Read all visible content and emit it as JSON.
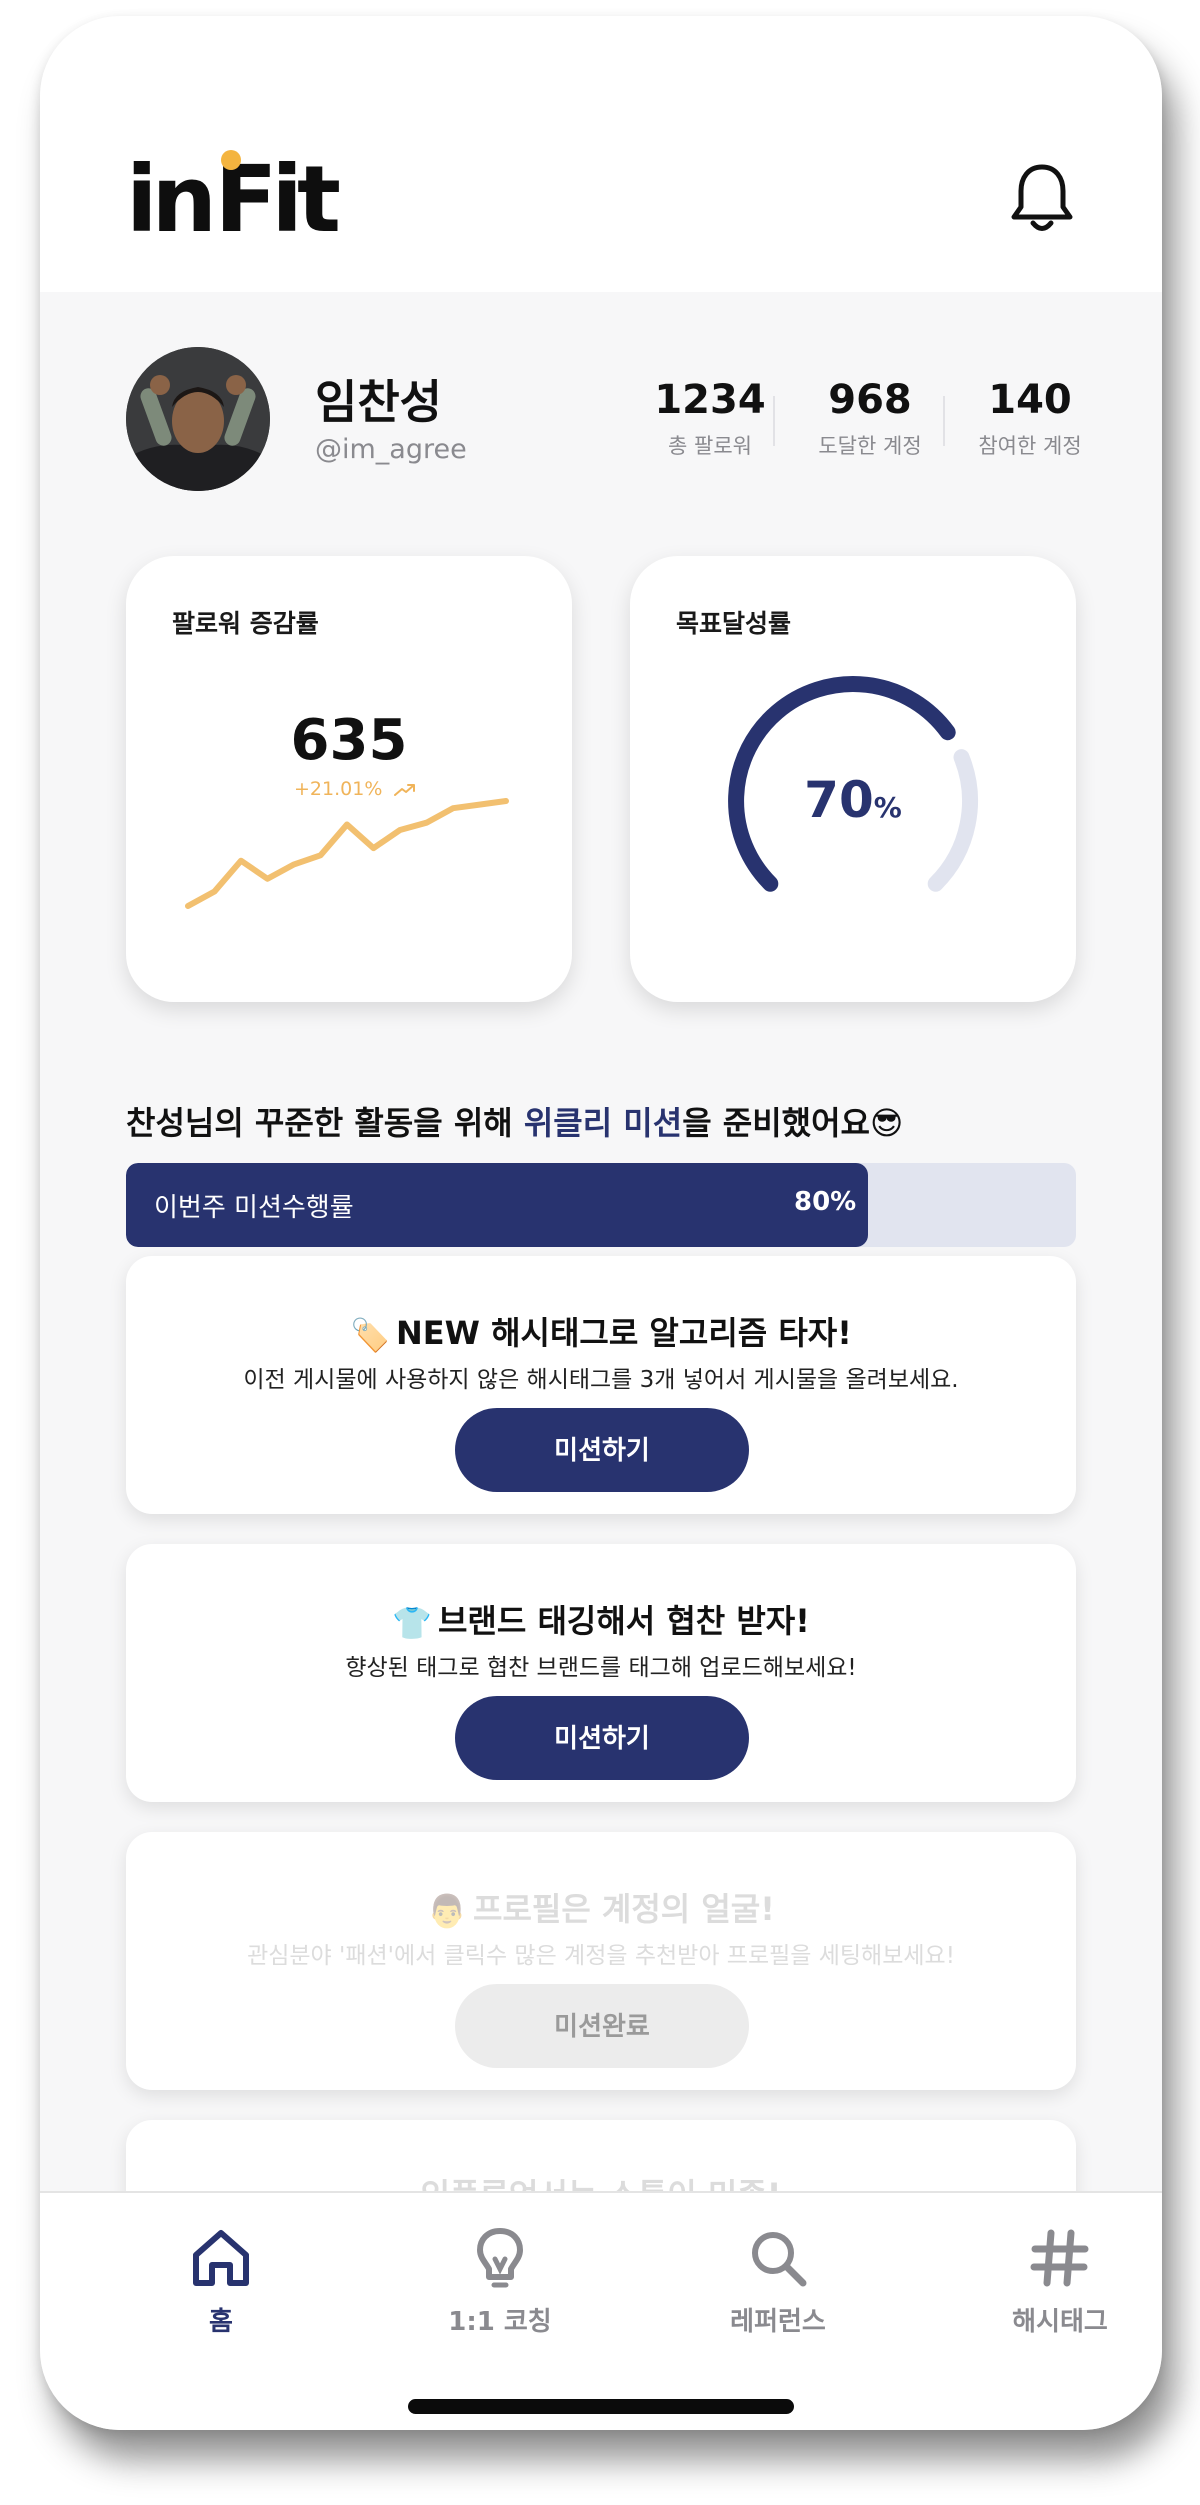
{
  "app": {
    "logo": "inFit"
  },
  "header": {
    "icon": "bell-icon"
  },
  "profile": {
    "name": "임찬성",
    "handle": "@im_agree",
    "stats": [
      {
        "value": "1234",
        "label": "총 팔로워"
      },
      {
        "value": "968",
        "label": "도달한 계정"
      },
      {
        "value": "140",
        "label": "참여한 계정"
      }
    ]
  },
  "follower_card": {
    "title": "팔로워 증감률",
    "value": "635",
    "change": "+21.01%",
    "trend_icon": "trend-up-icon",
    "sparkline": [
      10,
      18,
      35,
      25,
      33,
      38,
      55,
      42,
      52,
      56,
      64,
      66,
      68
    ],
    "color": "#f2c070"
  },
  "goal_card": {
    "title": "목표달성률",
    "value": "70",
    "unit": "%",
    "percent": 70,
    "color": "#28336f",
    "track_color": "#e1e4ef"
  },
  "weekly": {
    "headline_pre": "찬성님의 꾸준한 활동을 위해 ",
    "headline_highlight": "위클리 미션",
    "headline_post": "을 준비했어요😎",
    "progress_label": "이번주 미션수행률",
    "progress_value": "80%",
    "progress": 0.8
  },
  "missions": [
    {
      "emoji": "🏷️",
      "title": "NEW 해시태그로 알고리즘 타자!",
      "desc": "이전 게시물에 사용하지 않은 해시태그를 3개 넣어서 게시물을 올려보세요.",
      "button": "미션하기",
      "done": false
    },
    {
      "emoji": "👕",
      "title": "브랜드 태깅해서 협찬 받자!",
      "desc": "향상된 태그로 협찬 브랜드를 태그해 업로드해보세요!",
      "button": "미션하기",
      "done": false
    },
    {
      "emoji": "👨",
      "title": "프로필은 계정의 얼굴!",
      "desc": "관심분야 '패션'에서 클릭수 많은 계정을 추천받아 프로필을 세팅해보세요!",
      "button": "미션완료",
      "done": true
    },
    {
      "emoji": "",
      "title": "인플루언서는 소통이 미좀!",
      "desc": "",
      "button": "",
      "done": false
    }
  ],
  "tabs": [
    {
      "label": "홈",
      "icon": "home-icon",
      "active": true
    },
    {
      "label": "1:1 코칭",
      "icon": "lightbulb-icon",
      "active": false
    },
    {
      "label": "레퍼런스",
      "icon": "search-icon",
      "active": false
    },
    {
      "label": "해시태그",
      "icon": "hashtag-icon",
      "active": false
    }
  ],
  "colors": {
    "brand": "#28336f",
    "accent": "#f4b43f",
    "background": "#f7f7f8"
  }
}
